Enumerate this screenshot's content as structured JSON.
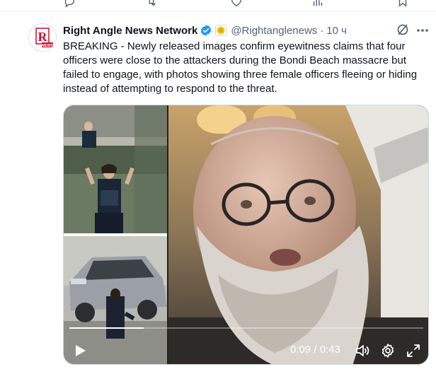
{
  "previous_tweet": {
    "reply_count": "",
    "repost_count": "",
    "like_count": "",
    "view_count": ""
  },
  "tweet": {
    "author_name": "Right Angle News Network",
    "handle": "@Rightanglenews",
    "separator": "·",
    "time": "10 ч",
    "text": "BREAKING - Newly released images confirm eyewitness claims that four officers were close to the attackers during the Bondi Beach massacre but failed to engage, with photos showing three female officers fleeing or hiding instead of attempting to respond to the threat.",
    "avatar_text": "NEWS",
    "verified_color": "#1d9bf0",
    "affiliate_color": "#f5c518"
  },
  "video": {
    "time_readout": "0:09 / 0:43",
    "progress": 0.21,
    "icons": [
      "play-icon",
      "volume-icon",
      "gear-icon",
      "fullscreen-icon"
    ]
  }
}
